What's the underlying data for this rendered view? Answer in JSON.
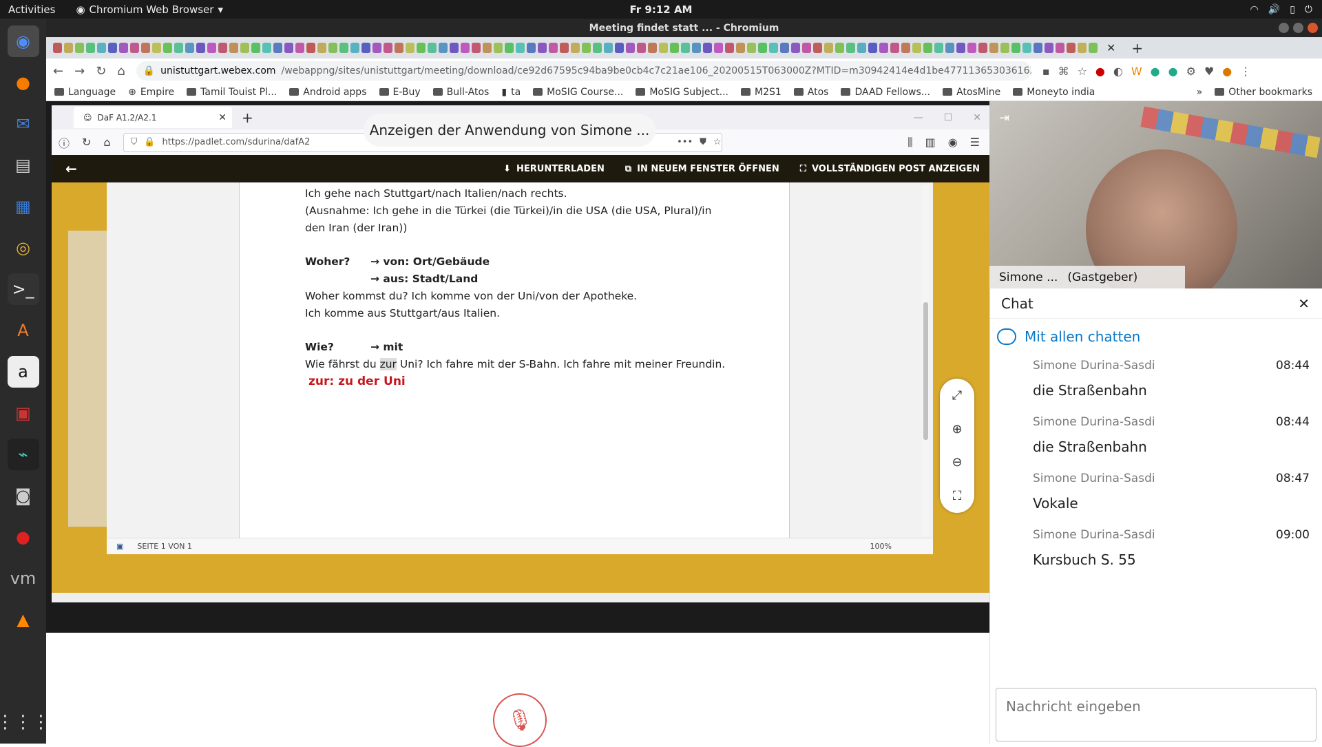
{
  "gnome": {
    "activities": "Activities",
    "app_menu": "Chromium Web Browser",
    "clock": "Fr  9:12 AM"
  },
  "dock": {
    "apps": [
      "chromium-icon",
      "firefox-icon",
      "thunderbird-icon",
      "files-icon",
      "writer-icon",
      "rhythmbox-icon",
      "terminal-icon",
      "software-icon",
      "amazon-icon",
      "screen-icon",
      "monitor-icon",
      "camera-icon",
      "cherry-icon",
      "vmware-icon",
      "vlc-icon"
    ]
  },
  "chromium": {
    "window_title": "Meeting findet statt ... - Chromium",
    "url_host": "unistuttgart.webex.com",
    "url_path": "/webappng/sites/unistuttgart/meeting/download/ce92d67595c94ba9be0cb4c7c21ae106_20200515T063000Z?MTID=m30942414e4d1be477113653036162165&launchApp...",
    "bookmarks": [
      "Language",
      "Empire",
      "Tamil Touist Pl...",
      "Android apps",
      "E-Buy",
      "Bull-Atos",
      "ta",
      "MoSIG Course...",
      "MoSIG Subject...",
      "M2S1",
      "Atos",
      "DAAD Fellows...",
      "AtosMine",
      "Moneyto india"
    ],
    "bookmarks_more": "»",
    "other_bookmarks": "Other bookmarks"
  },
  "share": {
    "banner": "Anzeigen der Anwendung von Simone ...",
    "firefox": {
      "tab_title": "DaF A1.2/A2.1",
      "url": "https://padlet.com/sdurina/dafA2"
    },
    "padlet": {
      "download": "HERUNTERLADEN",
      "open_new": "IN NEUEM FENSTER ÖFFNEN",
      "show_full": "VOLLSTÄNDIGEN POST ANZEIGEN"
    },
    "doc": {
      "line1": "Ich gehe nach Stuttgart/nach Italien/nach rechts.",
      "line2": "(Ausnahme: Ich gehe in die Türkei (die Türkei)/in die USA (die USA, Plural)/in",
      "line3": "den Iran (der Iran))",
      "woher_q": "Woher?",
      "woher_a1": "→ von: Ort/Gebäude",
      "woher_a2": "→ aus: Stadt/Land",
      "woher_ex1": "Woher kommst du? Ich komme von der Uni/von der Apotheke.",
      "woher_ex2": "Ich komme aus Stuttgart/aus Italien.",
      "wie_q": "Wie?",
      "wie_a": "→ mit",
      "wie_ex_pre": "Wie fährst du ",
      "wie_ex_hl": "zur",
      "wie_ex_post": " Uni? Ich fahre mit der S-Bahn. Ich fahre mit meiner Freundin.",
      "red_note": "zur: zu der Uni"
    },
    "status": {
      "page": "SEITE 1 VON 1",
      "zoom": "100%"
    }
  },
  "video": {
    "name": "Simone ...",
    "role": "(Gastgeber)"
  },
  "chat": {
    "title": "Chat",
    "target": "Mit allen chatten",
    "messages": [
      {
        "sender": "Simone Durina-Sasdi",
        "time": "08:44",
        "text": "die Straßenbahn"
      },
      {
        "sender": "Simone Durina-Sasdi",
        "time": "08:44",
        "text": "die Straßenbahn"
      },
      {
        "sender": "Simone Durina-Sasdi",
        "time": "08:47",
        "text": "Vokale"
      },
      {
        "sender": "Simone Durina-Sasdi",
        "time": "09:00",
        "text": "Kursbuch S. 55"
      }
    ],
    "input_placeholder": "Nachricht eingeben"
  }
}
